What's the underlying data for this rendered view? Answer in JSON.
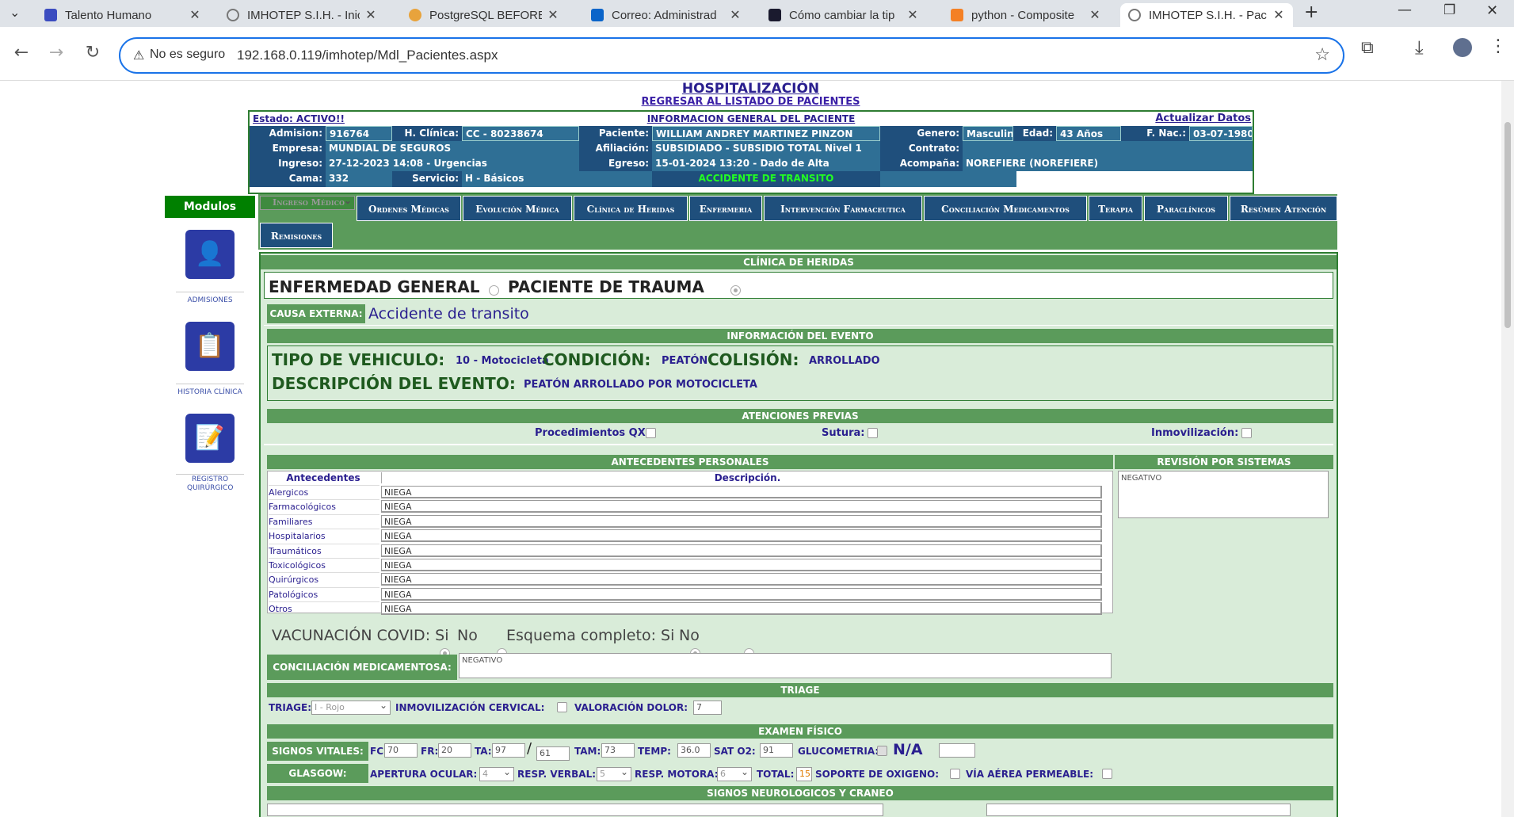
{
  "browser": {
    "tabs": [
      {
        "title": "Talento Humano",
        "icon": "talento-favicon",
        "color": "#3b4cc0"
      },
      {
        "title": "IMHOTEP S.I.H. - Inic",
        "icon": "globe-favicon",
        "color": "#888888"
      },
      {
        "title": "PostgreSQL BEFORE",
        "icon": "postgres-favicon",
        "color": "#e8a33c"
      },
      {
        "title": "Correo: Administrad",
        "icon": "outlook-favicon",
        "color": "#0a64c9"
      },
      {
        "title": "Cómo cambiar la tip",
        "icon": "stackexchange-favicon",
        "color": "#1a1a2e"
      },
      {
        "title": "python - Composite",
        "icon": "stackoverflow-favicon",
        "color": "#f48024"
      },
      {
        "title": "IMHOTEP S.I.H. - Pac",
        "icon": "globe-favicon",
        "color": "#888888"
      }
    ],
    "security_label": "No es seguro",
    "url": "192.168.0.119/imhotep/Mdl_Pacientes.aspx"
  },
  "header": {
    "title": "HOSPITALIZACIÓN",
    "back_link": "REGRESAR AL LISTADO DE PACIENTES"
  },
  "patient": {
    "estado": "Estado: ACTIVO!!",
    "section_title": "INFORMACION GENERAL DEL PACIENTE",
    "update_link": "Actualizar Datos",
    "admision_lbl": "Admision:",
    "admision": "916764",
    "hclinica_lbl": "H. Clínica:",
    "hclinica": "CC - 80238674",
    "paciente_lbl": "Paciente:",
    "paciente": "WILLIAM ANDREY MARTINEZ PINZON",
    "genero_lbl": "Genero:",
    "genero": "Masculin",
    "edad_lbl": "Edad:",
    "edad": "43 Años",
    "fnac_lbl": "F. Nac.:",
    "fnac": "03-07-1980",
    "empresa_lbl": "Empresa:",
    "empresa": "MUNDIAL DE SEGUROS",
    "afiliacion_lbl": "Afiliación:",
    "afiliacion": "SUBSIDIADO - SUBSIDIO TOTAL Nivel 1",
    "contrato_lbl": "Contrato:",
    "contrato": "",
    "ingreso_lbl": "Ingreso:",
    "ingreso": "27-12-2023 14:08 - Urgencias",
    "egreso_lbl": "Egreso:",
    "egreso": "15-01-2024 13:20 - Dado de Alta",
    "acompana_lbl": "Acompaña:",
    "acompana": "NOREFIERE (NOREFIERE)",
    "cama_lbl": "Cama:",
    "cama": "332",
    "servicio_lbl": "Servicio:",
    "servicio": "H - Básicos",
    "alert": "ACCIDENTE DE TRANSITO"
  },
  "sidebar": {
    "title": "Modulos",
    "items": [
      {
        "label": "ADMISIONES",
        "icon": "admissions-icon"
      },
      {
        "label": "HISTORIA CLÍNICA",
        "icon": "medical-history-icon"
      },
      {
        "label": "REGISTRO QUIRÚRGICO",
        "icon": "surgical-record-icon"
      }
    ]
  },
  "menu": {
    "tabs": [
      "Ingreso Médico",
      "Ordenes Médicas",
      "Evolución Médica",
      "Clínica de Heridas",
      "Enfermeria",
      "Intervención Farmaceutica",
      "Conciliación Medicamentos",
      "Terapia",
      "Paraclínicos",
      "Resúmen Atención",
      "Remisiones"
    ]
  },
  "form": {
    "section_title": "CLÍNICA DE HERIDAS",
    "enfermedad_general": "ENFERMEDAD GENERAL",
    "paciente_trauma": "PACIENTE DE TRAUMA",
    "causa_lbl": "CAUSA EXTERNA:",
    "causa": "Accidente de transito",
    "evento_title": "INFORMACIÓN DEL EVENTO",
    "tipo_vehiculo_lbl": "TIPO DE VEHICULO:",
    "tipo_vehiculo": "10 - Motocicleta",
    "condicion_lbl": "CONDICIÓN:",
    "condicion": "PEATÓN",
    "colision_lbl": "COLISIÓN:",
    "colision": "ARROLLADO",
    "descripcion_lbl": "DESCRIPCIÓN DEL EVENTO:",
    "descripcion": "PEATÓN ARROLLADO POR MOTOCICLETA",
    "atenciones_title": "ATENCIONES PREVIAS",
    "proc_qx": "Procedimientos QX:",
    "sutura": "Sutura:",
    "inmovilizacion": "Inmovilización:",
    "antecedentes_title": "ANTECEDENTES PERSONALES",
    "revision_title": "REVISIÓN POR SISTEMAS",
    "revision_value": "NEGATIVO",
    "ant_col1": "Antecedentes",
    "ant_col2": "Descripción.",
    "antecedentes": [
      {
        "name": "Alergicos",
        "value": "NIEGA"
      },
      {
        "name": "Farmacológicos",
        "value": "NIEGA"
      },
      {
        "name": "Familiares",
        "value": "NIEGA"
      },
      {
        "name": "Hospitalarios",
        "value": "NIEGA"
      },
      {
        "name": "Traumáticos",
        "value": "NIEGA"
      },
      {
        "name": "Toxicológicos",
        "value": "NIEGA"
      },
      {
        "name": "Quirúrgicos",
        "value": "NIEGA"
      },
      {
        "name": "Patológicos",
        "value": "NIEGA"
      },
      {
        "name": "Otros",
        "value": "NIEGA"
      }
    ],
    "vac_covid": "VACUNACIÓN COVID: Si",
    "no1": "No",
    "esquema": "Esquema completo: Si",
    "no2": "No",
    "conciliacion_lbl": "CONCILIACIÓN MEDICAMENTOSA:",
    "conciliacion": "NEGATIVO",
    "triage_title": "TRIAGE",
    "triage_lbl": "TRIAGE:",
    "triage_value": "I - Rojo",
    "inmov_cervical": "INMOVILIZACIÓN CERVICAL:",
    "valoracion_dolor": "VALORACIÓN DOLOR:",
    "dolor_value": "7",
    "examen_title": "EXAMEN FÍSICO",
    "signos_lbl": "SIGNOS VITALES:",
    "fc_lbl": "FC",
    "fc": "70",
    "fr_lbl": "FR:",
    "fr": "20",
    "ta_lbl": "TA:",
    "ta_sys": "97",
    "ta_sep": "/",
    "ta_dia": "61",
    "tam_lbl": "TAM:",
    "tam": "73",
    "temp_lbl": "TEMP:",
    "temp": "36.0",
    "sat_lbl": "SAT O2:",
    "sat": "91",
    "gluco_lbl": "GLUCOMETRIA:",
    "gluco_na": "N/A",
    "gluco": "",
    "glasgow_lbl": "GLASGOW:",
    "apertura_lbl": "APERTURA OCULAR:",
    "apertura": "4",
    "verbal_lbl": "RESP. VERBAL:",
    "verbal": "5",
    "motora_lbl": "RESP. MOTORA:",
    "motora": "6",
    "total_lbl": "TOTAL:",
    "total": "15",
    "soporte_lbl": "SOPORTE DE OXIGENO:",
    "via_aerea_lbl": "VÍA AÉREA PERMEABLE:",
    "neuro_title": "SIGNOS NEUROLOGICOS Y CRANEO"
  },
  "colors": {
    "green": "#5b9b5b",
    "navy": "#1f4f7c",
    "purple_text": "#2a1f8f",
    "alert": "#22ff22"
  }
}
